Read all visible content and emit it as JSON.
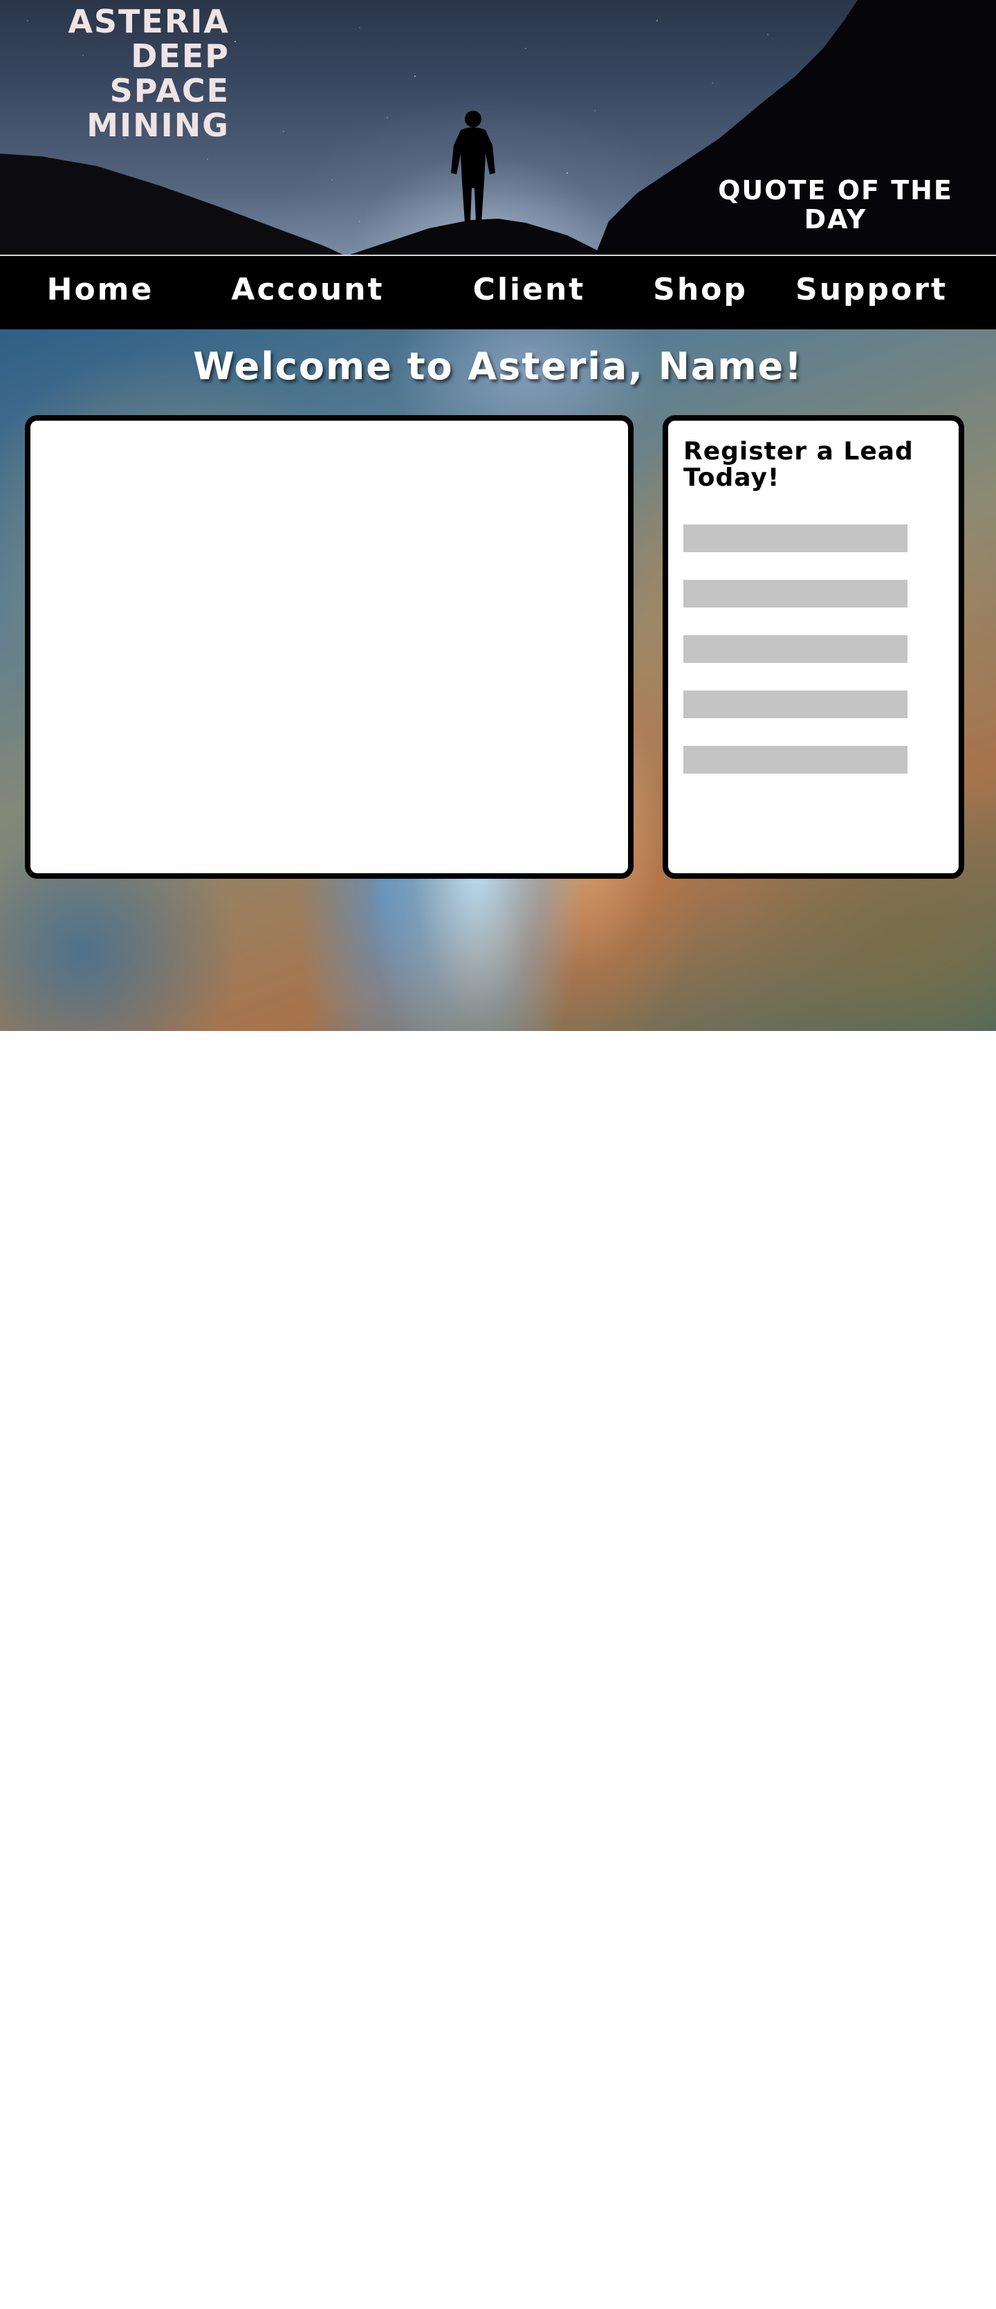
{
  "header": {
    "brand_lines": [
      "ASTERIA",
      "DEEP",
      "SPACE",
      "MINING"
    ],
    "quote_title": "QUOTE OF THE DAY"
  },
  "nav": {
    "items": [
      {
        "label": "Home"
      },
      {
        "label": "Account"
      },
      {
        "label": "Client"
      },
      {
        "label": "Shop"
      },
      {
        "label": "Support"
      }
    ]
  },
  "main": {
    "welcome": "Welcome to Asteria, Name!",
    "register": {
      "title": "Register a Lead Today!",
      "fields": [
        {
          "value": "",
          "placeholder": ""
        },
        {
          "value": "",
          "placeholder": ""
        },
        {
          "value": "",
          "placeholder": ""
        },
        {
          "value": "",
          "placeholder": ""
        },
        {
          "value": "",
          "placeholder": ""
        }
      ]
    }
  },
  "colors": {
    "nav_background": "#000000",
    "nav_text": "#ffffff",
    "field_background": "#c4c4c4",
    "card_border": "#000000",
    "brand_text": "#efe3e3"
  }
}
